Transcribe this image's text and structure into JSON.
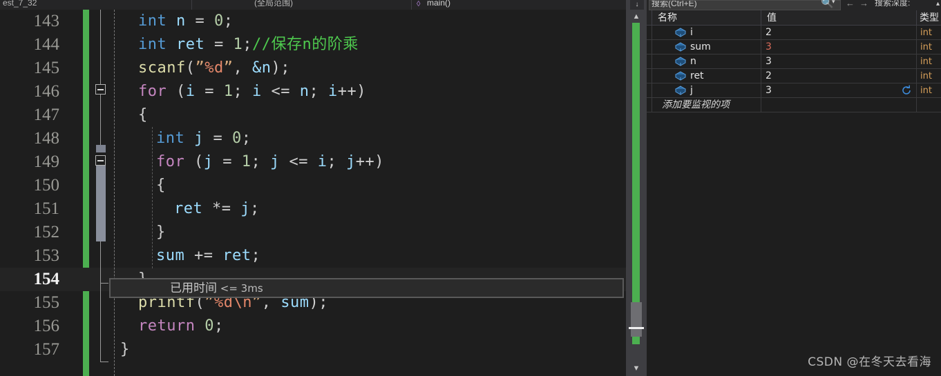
{
  "window": {
    "tabs": [
      {
        "label": "est_7_32"
      },
      {
        "label": "(全局范围)"
      },
      {
        "label": "main()"
      }
    ],
    "member_icon": "method-icon",
    "dropdown_caret": "▾",
    "scroll_top_nub": "↓"
  },
  "editor": {
    "lines": [
      {
        "no": "143",
        "current": false,
        "tokens": [
          {
            "t": "int",
            "c": "typ"
          },
          {
            "t": " ",
            "c": "pun"
          },
          {
            "t": "n",
            "c": "var"
          },
          {
            "t": " = ",
            "c": "pun"
          },
          {
            "t": "0",
            "c": "num"
          },
          {
            "t": ";",
            "c": "pun"
          }
        ],
        "indent": 2
      },
      {
        "no": "144",
        "current": false,
        "tokens": [
          {
            "t": "int",
            "c": "typ"
          },
          {
            "t": " ",
            "c": "pun"
          },
          {
            "t": "ret",
            "c": "var"
          },
          {
            "t": " = ",
            "c": "pun"
          },
          {
            "t": "1",
            "c": "num"
          },
          {
            "t": ";",
            "c": "pun"
          },
          {
            "t": "//保存n的阶乘",
            "c": "cmt"
          }
        ],
        "indent": 2
      },
      {
        "no": "145",
        "current": false,
        "tokens": [
          {
            "t": "scanf",
            "c": "fn"
          },
          {
            "t": "(",
            "c": "pun"
          },
          {
            "t": "”",
            "c": "str"
          },
          {
            "t": "%d",
            "c": "fmt"
          },
          {
            "t": "”",
            "c": "str"
          },
          {
            "t": ", ",
            "c": "pun"
          },
          {
            "t": "&n",
            "c": "amp"
          },
          {
            "t": ");",
            "c": "pun"
          }
        ],
        "indent": 2
      },
      {
        "no": "146",
        "current": false,
        "tokens": [
          {
            "t": "for",
            "c": "kw"
          },
          {
            "t": " (",
            "c": "pun"
          },
          {
            "t": "i",
            "c": "var"
          },
          {
            "t": " = ",
            "c": "pun"
          },
          {
            "t": "1",
            "c": "num"
          },
          {
            "t": "; ",
            "c": "pun"
          },
          {
            "t": "i",
            "c": "var"
          },
          {
            "t": " <= ",
            "c": "pun"
          },
          {
            "t": "n",
            "c": "var"
          },
          {
            "t": "; ",
            "c": "pun"
          },
          {
            "t": "i",
            "c": "var"
          },
          {
            "t": "++)",
            "c": "pun"
          }
        ],
        "indent": 2
      },
      {
        "no": "147",
        "current": false,
        "tokens": [
          {
            "t": "{",
            "c": "pun"
          }
        ],
        "indent": 2
      },
      {
        "no": "148",
        "current": false,
        "tokens": [
          {
            "t": "int",
            "c": "typ"
          },
          {
            "t": " ",
            "c": "pun"
          },
          {
            "t": "j",
            "c": "var"
          },
          {
            "t": " = ",
            "c": "pun"
          },
          {
            "t": "0",
            "c": "num"
          },
          {
            "t": ";",
            "c": "pun"
          }
        ],
        "indent": 3
      },
      {
        "no": "149",
        "current": false,
        "tokens": [
          {
            "t": "for",
            "c": "kw"
          },
          {
            "t": " (",
            "c": "pun"
          },
          {
            "t": "j",
            "c": "var"
          },
          {
            "t": " = ",
            "c": "pun"
          },
          {
            "t": "1",
            "c": "num"
          },
          {
            "t": "; ",
            "c": "pun"
          },
          {
            "t": "j",
            "c": "var"
          },
          {
            "t": " <= ",
            "c": "pun"
          },
          {
            "t": "i",
            "c": "var"
          },
          {
            "t": "; ",
            "c": "pun"
          },
          {
            "t": "j",
            "c": "var"
          },
          {
            "t": "++)",
            "c": "pun"
          }
        ],
        "indent": 3
      },
      {
        "no": "150",
        "current": false,
        "tokens": [
          {
            "t": "{",
            "c": "pun"
          }
        ],
        "indent": 3
      },
      {
        "no": "151",
        "current": false,
        "tokens": [
          {
            "t": "ret",
            "c": "var"
          },
          {
            "t": " *= ",
            "c": "pun"
          },
          {
            "t": "j",
            "c": "var"
          },
          {
            "t": ";",
            "c": "pun"
          }
        ],
        "indent": 4
      },
      {
        "no": "152",
        "current": false,
        "tokens": [
          {
            "t": "}",
            "c": "pun"
          }
        ],
        "indent": 3
      },
      {
        "no": "153",
        "current": false,
        "tokens": [
          {
            "t": "sum",
            "c": "var"
          },
          {
            "t": " += ",
            "c": "pun"
          },
          {
            "t": "ret",
            "c": "var"
          },
          {
            "t": ";",
            "c": "pun"
          }
        ],
        "indent": 3
      },
      {
        "no": "154",
        "current": true,
        "tokens": [
          {
            "t": "}",
            "c": "pun"
          }
        ],
        "indent": 2
      },
      {
        "no": "155",
        "current": false,
        "tokens": [
          {
            "t": "printf",
            "c": "fn"
          },
          {
            "t": "(",
            "c": "pun"
          },
          {
            "t": "”",
            "c": "str"
          },
          {
            "t": "%d",
            "c": "fmt"
          },
          {
            "t": "\\n",
            "c": "fmt"
          },
          {
            "t": "”",
            "c": "str"
          },
          {
            "t": ", ",
            "c": "pun"
          },
          {
            "t": "sum",
            "c": "var"
          },
          {
            "t": ");",
            "c": "pun"
          }
        ],
        "indent": 2
      },
      {
        "no": "156",
        "current": false,
        "tokens": [
          {
            "t": "return",
            "c": "kw"
          },
          {
            "t": " ",
            "c": "pun"
          },
          {
            "t": "0",
            "c": "num"
          },
          {
            "t": ";",
            "c": "pun"
          }
        ],
        "indent": 2
      },
      {
        "no": "157",
        "current": false,
        "tokens": [
          {
            "t": "}",
            "c": "pun"
          }
        ],
        "indent": 1
      }
    ],
    "elapsed_label": "已用时间",
    "elapsed_value": "<= 3ms",
    "change_bar_color": "#4caf50",
    "fold_icons": [
      "collapse-minus-icon",
      "collapse-minus-icon"
    ],
    "scroll_up_arrow": "▲",
    "scroll_down_arrow": "▼"
  },
  "watch": {
    "search_placeholder": "搜索(Ctrl+E)",
    "search_value": "",
    "magnifier_icon": "search-icon",
    "magnifier_caret": "▾",
    "back_arrow": "←",
    "forward_arrow": "→",
    "depth_label": "搜索深度:",
    "depth_caret": "▴",
    "columns": [
      "名称",
      "值",
      "类型"
    ],
    "rows": [
      {
        "name": "i",
        "value": "2",
        "type": "int",
        "changed": false,
        "refresh": false
      },
      {
        "name": "sum",
        "value": "3",
        "type": "int",
        "changed": true,
        "refresh": false
      },
      {
        "name": "n",
        "value": "3",
        "type": "int",
        "changed": false,
        "refresh": false
      },
      {
        "name": "ret",
        "value": "2",
        "type": "int",
        "changed": false,
        "refresh": false
      },
      {
        "name": "j",
        "value": "3",
        "type": "int",
        "changed": false,
        "refresh": true
      }
    ],
    "add_watch_label": "添加要监视的项",
    "refresh_icon": "refresh-icon",
    "value_icon": "variable-box-icon",
    "changed_value_color": "#d96b5a",
    "type_color": "#d8a05a"
  },
  "watermark": {
    "text": "CSDN @在冬天去看海"
  }
}
